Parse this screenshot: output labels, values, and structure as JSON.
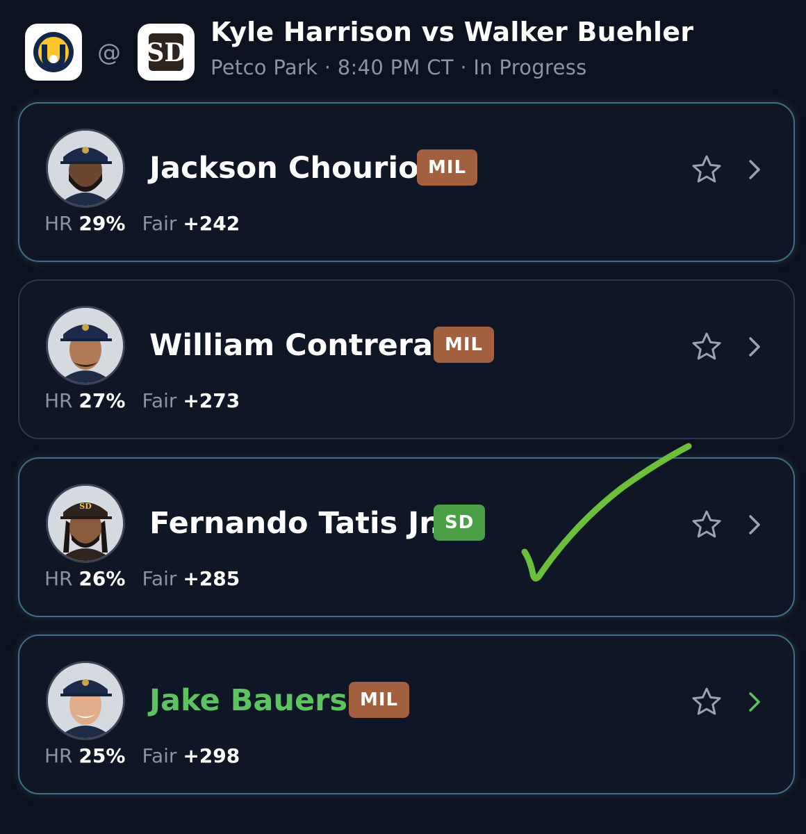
{
  "header": {
    "away_team_logo": "milwaukee-brewers-logo",
    "home_team_logo": "san-diego-padres-logo",
    "at_symbol": "@",
    "title": "Kyle Harrison vs Walker Buehler",
    "meta": "Petco Park · 8:40 PM CT · In Progress"
  },
  "players": [
    {
      "name": "Jackson Chourio",
      "team": "MIL",
      "hr_label": "HR",
      "hr": "29%",
      "fair_label": "Fair",
      "fair": "+242",
      "highlight": false
    },
    {
      "name": "William Contreras",
      "team": "MIL",
      "hr_label": "HR",
      "hr": "27%",
      "fair_label": "Fair",
      "fair": "+273",
      "highlight": false
    },
    {
      "name": "Fernando Tatis Jr.",
      "team": "SD",
      "hr_label": "HR",
      "hr": "26%",
      "fair_label": "Fair",
      "fair": "+285",
      "highlight": false
    },
    {
      "name": "Jake Bauers",
      "team": "MIL",
      "hr_label": "HR",
      "hr": "25%",
      "fair_label": "Fair",
      "fair": "+298",
      "highlight": true
    }
  ],
  "icons": {
    "favorite": "star-icon",
    "open": "chevron-right-icon",
    "annotation": "checkmark-icon"
  },
  "colors": {
    "background": "#0d1220",
    "card_border": "#3e6f87",
    "mil_badge": "#a2603f",
    "sd_badge": "#4ba047",
    "highlight": "#5cc35e",
    "checkmark": "#6cbf3a"
  }
}
